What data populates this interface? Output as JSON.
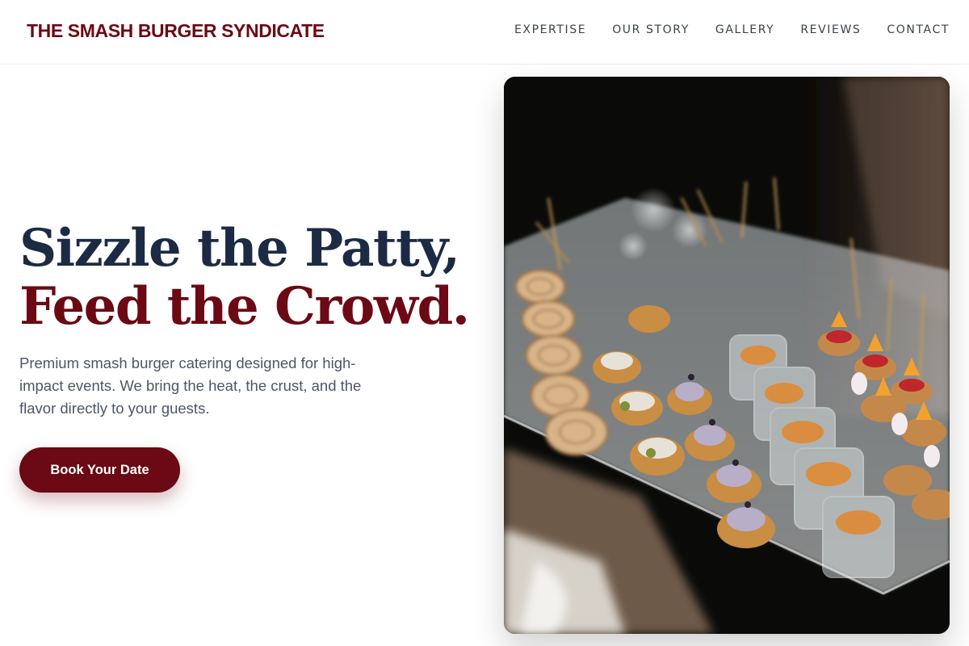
{
  "brand": {
    "name": "THE SMASH BURGER SYNDICATE"
  },
  "nav": {
    "items": [
      "EXPERTISE",
      "OUR STORY",
      "GALLERY",
      "REVIEWS",
      "CONTACT"
    ]
  },
  "hero": {
    "headline_line1": "Sizzle the Patty,",
    "headline_line2": "Feed the Crowd.",
    "subtext": "Premium smash burger catering designed for high-impact events. We bring the heat, the crust, and the flavor directly to your guests.",
    "cta_label": "Book Your Date"
  },
  "colors": {
    "brand": "#6b0a14",
    "headline_dark": "#1c2a44",
    "body_text": "#4d5566",
    "nav_text": "#3c4150"
  },
  "photo": {
    "subject": "catering-platter-photo"
  }
}
